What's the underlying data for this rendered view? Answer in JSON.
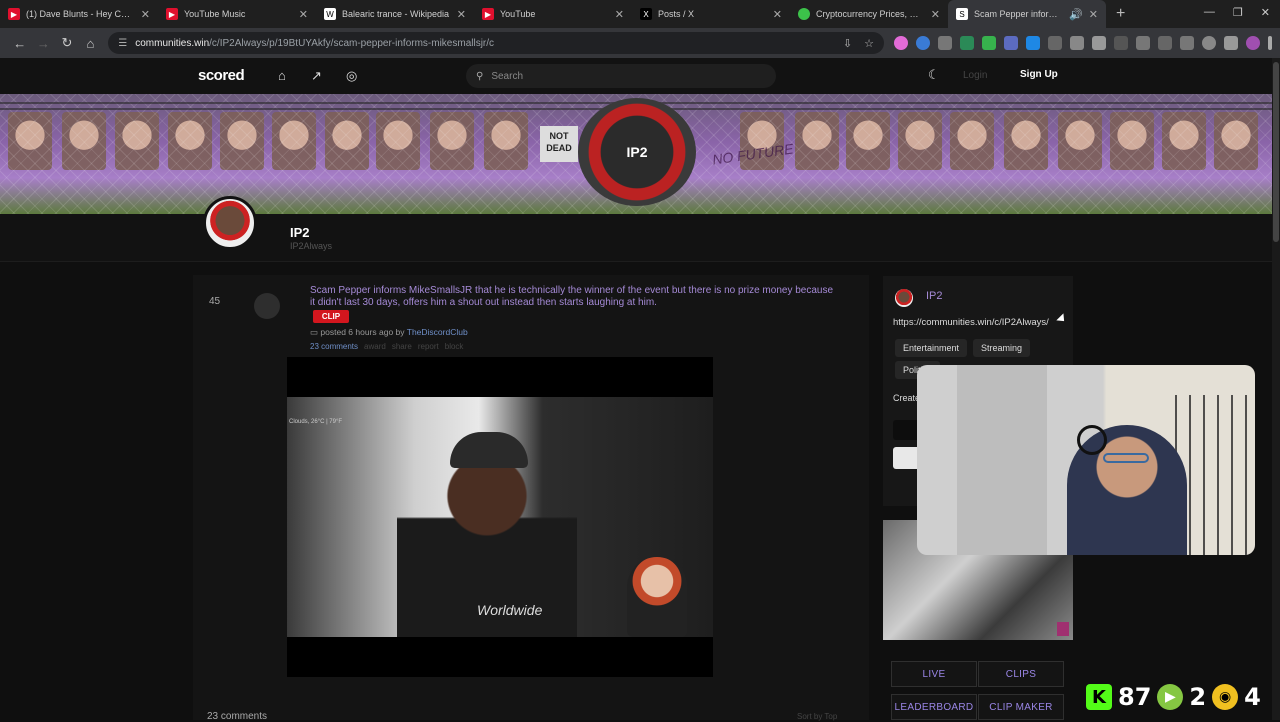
{
  "browser": {
    "tabs": [
      {
        "title": "(1) Dave Blunts - Hey Curtis (O",
        "fav_color": "#e0102e",
        "active": false
      },
      {
        "title": "YouTube Music",
        "fav_color": "#e0102e",
        "active": false
      },
      {
        "title": "Balearic trance - Wikipedia",
        "fav_color": "#ffffff",
        "active": false
      },
      {
        "title": "YouTube",
        "fav_color": "#e0102e",
        "active": false
      },
      {
        "title": "Posts / X",
        "fav_color": "#000000",
        "active": false
      },
      {
        "title": "Cryptocurrency Prices, Charts, a",
        "fav_color": "#3cc24a",
        "active": false
      },
      {
        "title": "Scam Pepper informs Mike",
        "fav_color": "#ffffff",
        "active": true
      }
    ],
    "url_host": "communities.win",
    "url_path": "/c/IP2Always/p/19BtUYAkfy/scam-pepper-informs-mikesmallsjr/c"
  },
  "site": {
    "logo": "scored",
    "search_placeholder": "Search",
    "login_label": "Login",
    "signup_label": "Sign Up"
  },
  "banner": {
    "sign_text": "NOT DEAD",
    "center_text": "IP2",
    "graffiti": "NO FUTURE"
  },
  "community": {
    "name": "IP2",
    "handle": "IP2Always"
  },
  "post": {
    "score": "45",
    "title": "Scam Pepper informs MikeSmallsJR that he is technically the winner of the event but there is no prize money because it didn't last 30 days, offers him a shout out instead then starts laughing at him.",
    "flair": "CLIP",
    "posted_prefix": "posted 6 hours ago by",
    "author": "TheDiscordClub",
    "comments_link": "23 comments",
    "actions": [
      "award",
      "share",
      "report",
      "block"
    ],
    "video_weather": "Clouds, 26°C | 79°F",
    "video_shirt_text": "Worldwide"
  },
  "comments": {
    "count_label": "23 comments",
    "sort_label": "Sort by Top"
  },
  "sidebar": {
    "name": "IP2",
    "url": "https://communities.win/c/IP2Always/",
    "tags": [
      "Entertainment",
      "Streaming",
      "Politics"
    ],
    "created_label": "Created",
    "buttons": [
      "LIVE",
      "CLIPS",
      "LEADERBOARD",
      "CLIP MAKER"
    ]
  },
  "overlay": {
    "kick_count": "87",
    "rumble_count": "2",
    "other_count": "4"
  }
}
